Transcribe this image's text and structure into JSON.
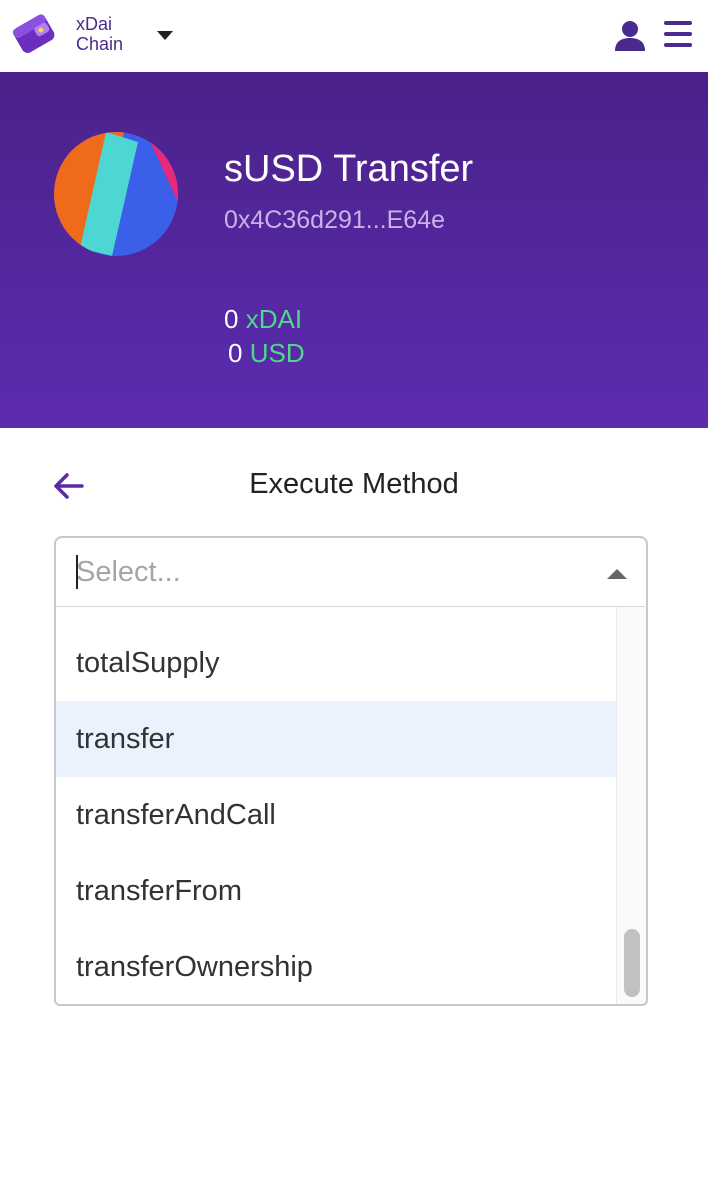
{
  "network": {
    "line1": "xDai",
    "line2": "Chain"
  },
  "contract": {
    "name": "sUSD Transfer",
    "address": "0x4C36d291...E64e",
    "balances": [
      {
        "amount": "0",
        "unit": "xDAI"
      },
      {
        "amount": "0",
        "unit": "USD"
      }
    ]
  },
  "section": {
    "title": "Execute Method"
  },
  "select": {
    "placeholder": "Select...",
    "value": "",
    "options": [
      "totalSupply",
      "transfer",
      "transferAndCall",
      "transferFrom",
      "transferOwnership"
    ],
    "highlighted": "transfer"
  },
  "colors": {
    "brand_purple": "#4a2a8e",
    "banner_top": "#4a2289",
    "banner_bottom": "#5c2bb0",
    "balance_unit": "#4bd98a",
    "highlight": "#eaf2fe"
  },
  "icons": {
    "logo": "wallet-logo-icon",
    "network_caret": "caret-down-icon",
    "user": "user-icon",
    "menu": "hamburger-menu-icon",
    "back": "arrow-left-icon",
    "select_toggle": "caret-up-icon"
  }
}
